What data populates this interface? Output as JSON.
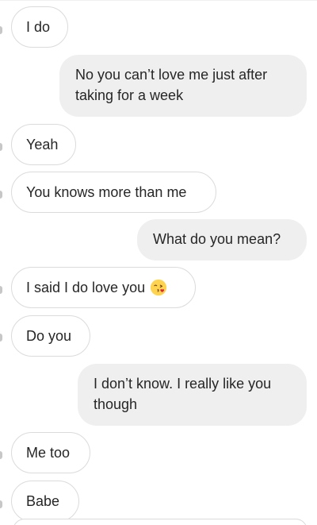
{
  "thread": {
    "messages": [
      {
        "sender": "them",
        "text": "I do"
      },
      {
        "sender": "me",
        "text": "No you can’t love me just after taking for a week"
      },
      {
        "sender": "them",
        "text": "Yeah"
      },
      {
        "sender": "them",
        "text": "You knows more than me"
      },
      {
        "sender": "me",
        "text": "What do you mean?"
      },
      {
        "sender": "them",
        "text": "I said I do love you",
        "emoji": "face-blowing-a-kiss-icon"
      },
      {
        "sender": "them",
        "text": "Do you"
      },
      {
        "sender": "me",
        "text": "I don’t know. I really like you though"
      },
      {
        "sender": "them",
        "text": "Me too"
      },
      {
        "sender": "them",
        "text": "Babe"
      }
    ]
  },
  "colors": {
    "received_bubble_bg": "#ffffff",
    "received_bubble_border": "#dbdbdb",
    "sent_bubble_bg": "#efefef",
    "text": "#262626"
  }
}
